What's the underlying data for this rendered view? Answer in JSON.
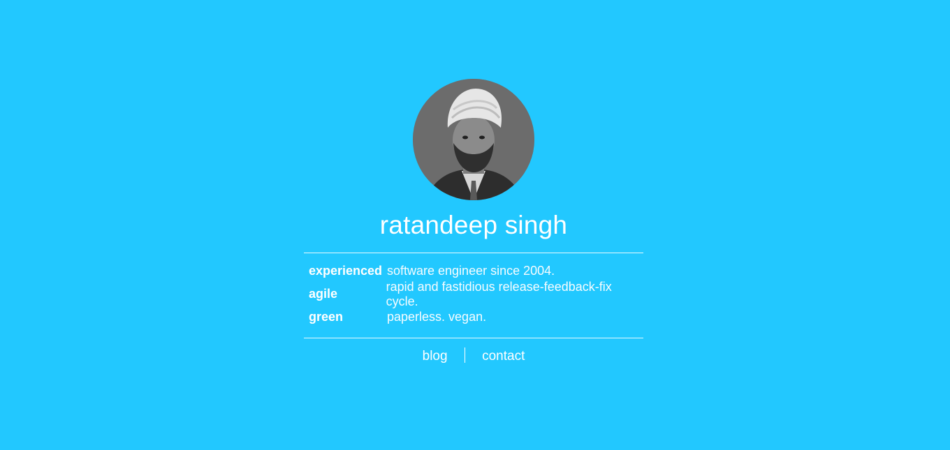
{
  "profile": {
    "name": "ratandeep singh",
    "avatar_alt": "profile photo"
  },
  "traits": [
    {
      "key": "experienced",
      "value": "software engineer since 2004."
    },
    {
      "key": "agile",
      "value": "rapid and fastidious release-feedback-fix cycle."
    },
    {
      "key": "green",
      "value": "paperless. vegan."
    }
  ],
  "nav": {
    "blog": "blog",
    "contact": "contact"
  },
  "colors": {
    "background": "#22c8ff",
    "text": "#ffffff"
  }
}
